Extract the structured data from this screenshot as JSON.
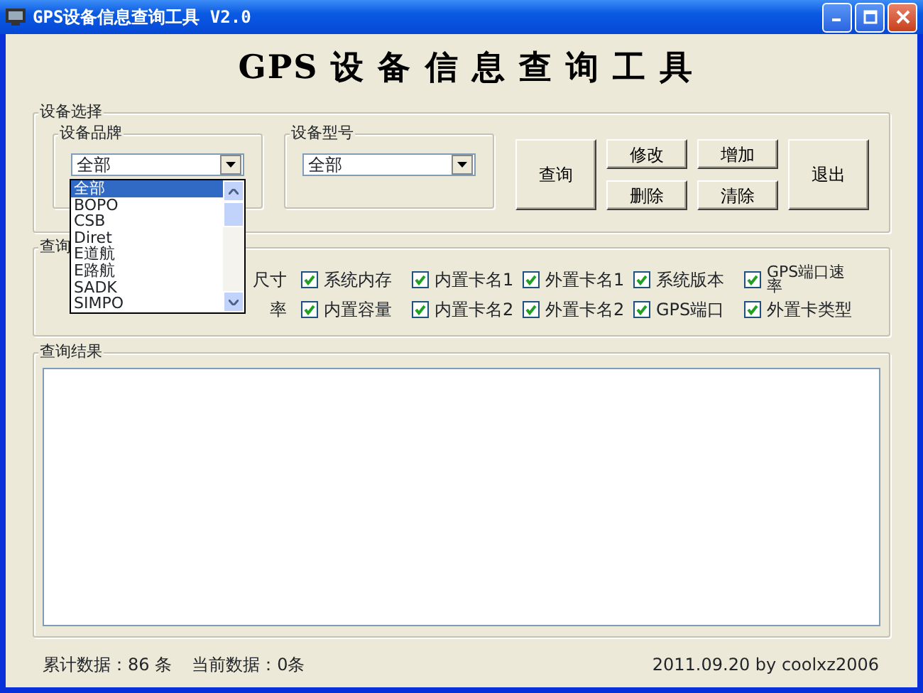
{
  "window": {
    "title": "GPS设备信息查询工具 V2.0"
  },
  "heading": "GPS 设 备 信 息 查 询 工 具",
  "device_select": {
    "label": "设备选择",
    "brand": {
      "label": "设备品牌",
      "value": "全部",
      "expanded": true,
      "options": [
        {
          "label": "全部",
          "selected": true
        },
        {
          "label": "BOPO",
          "selected": false
        },
        {
          "label": "CSB",
          "selected": false
        },
        {
          "label": "Diret",
          "selected": false
        },
        {
          "label": "E道航",
          "selected": false
        },
        {
          "label": "E路航",
          "selected": false
        },
        {
          "label": "SADK",
          "selected": false
        },
        {
          "label": "SIMPO",
          "selected": false
        }
      ]
    },
    "model": {
      "label": "设备型号",
      "value": "全部"
    }
  },
  "buttons": [
    {
      "label": "查询",
      "kind": "large"
    },
    {
      "label": "修改",
      "kind": "small"
    },
    {
      "label": "增加",
      "kind": "small"
    },
    {
      "label": "删除",
      "kind": "small"
    },
    {
      "label": "清除",
      "kind": "small"
    },
    {
      "label": "退出",
      "kind": "large"
    }
  ],
  "query": {
    "label": "查询",
    "rows": [
      {
        "items": [
          {
            "label": "尺寸",
            "kind": "partial"
          },
          {
            "label": "系统内存",
            "kind": "checkbox",
            "checked": true
          },
          {
            "label": "内置卡名1",
            "kind": "checkbox",
            "checked": true
          },
          {
            "label": "外置卡名1",
            "kind": "checkbox",
            "checked": true
          },
          {
            "label": "系统版本",
            "kind": "checkbox",
            "checked": true
          },
          {
            "label": "GPS端口速率",
            "kind": "checkbox",
            "checked": true
          }
        ]
      },
      {
        "items": [
          {
            "label": "率",
            "kind": "partial"
          },
          {
            "label": "内置容量",
            "kind": "checkbox",
            "checked": true
          },
          {
            "label": "内置卡名2",
            "kind": "checkbox",
            "checked": true
          },
          {
            "label": "外置卡名2",
            "kind": "checkbox",
            "checked": true
          },
          {
            "label": "GPS端口",
            "kind": "checkbox",
            "checked": true
          },
          {
            "label": "外置卡类型",
            "kind": "checkbox",
            "checked": true
          }
        ]
      }
    ]
  },
  "results": {
    "label": "查询结果"
  },
  "status": {
    "total": "累计数据：86 条",
    "current": "当前数据：0条",
    "credit": "2011.09.20 by coolxz2006"
  }
}
